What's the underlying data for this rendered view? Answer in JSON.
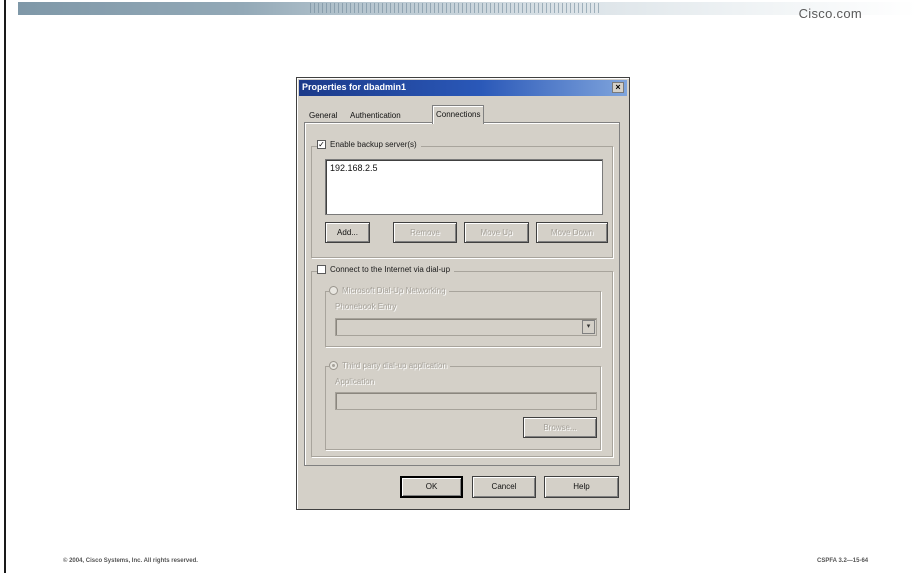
{
  "header": {
    "brand": "Cisco.com"
  },
  "footer": {
    "copyright": "© 2004, Cisco Systems, Inc. All rights reserved.",
    "course_code": "CSPFA 3.2—15-64"
  },
  "dialog": {
    "title": "Properties for dbadmin1",
    "close_glyph": "×",
    "tabs": [
      {
        "label": "General"
      },
      {
        "label": "Authentication"
      },
      {
        "label": "Connections"
      }
    ],
    "active_tab": "Connections",
    "backup": {
      "checkbox_label": "Enable backup server(s)",
      "checked": true,
      "check_glyph": "✓",
      "servers": [
        "192.168.2.5"
      ],
      "buttons": {
        "add": "Add...",
        "remove": "Remove",
        "move_up": "Move Up",
        "move_down": "Move Down"
      }
    },
    "dialup": {
      "checkbox_label": "Connect to the Internet via dial-up",
      "checked": false,
      "radio_dun_label": "Microsoft Dial-Up Networking",
      "phonebook_label": "Phonebook Entry",
      "phonebook_value": "",
      "radio_3rd_label": "Third party dial-up application",
      "application_label": "Application",
      "application_value": "",
      "browse": "Browse..."
    },
    "footer_buttons": {
      "ok": "OK",
      "cancel": "Cancel",
      "help": "Help"
    },
    "combo_arrow_glyph": "▾"
  }
}
